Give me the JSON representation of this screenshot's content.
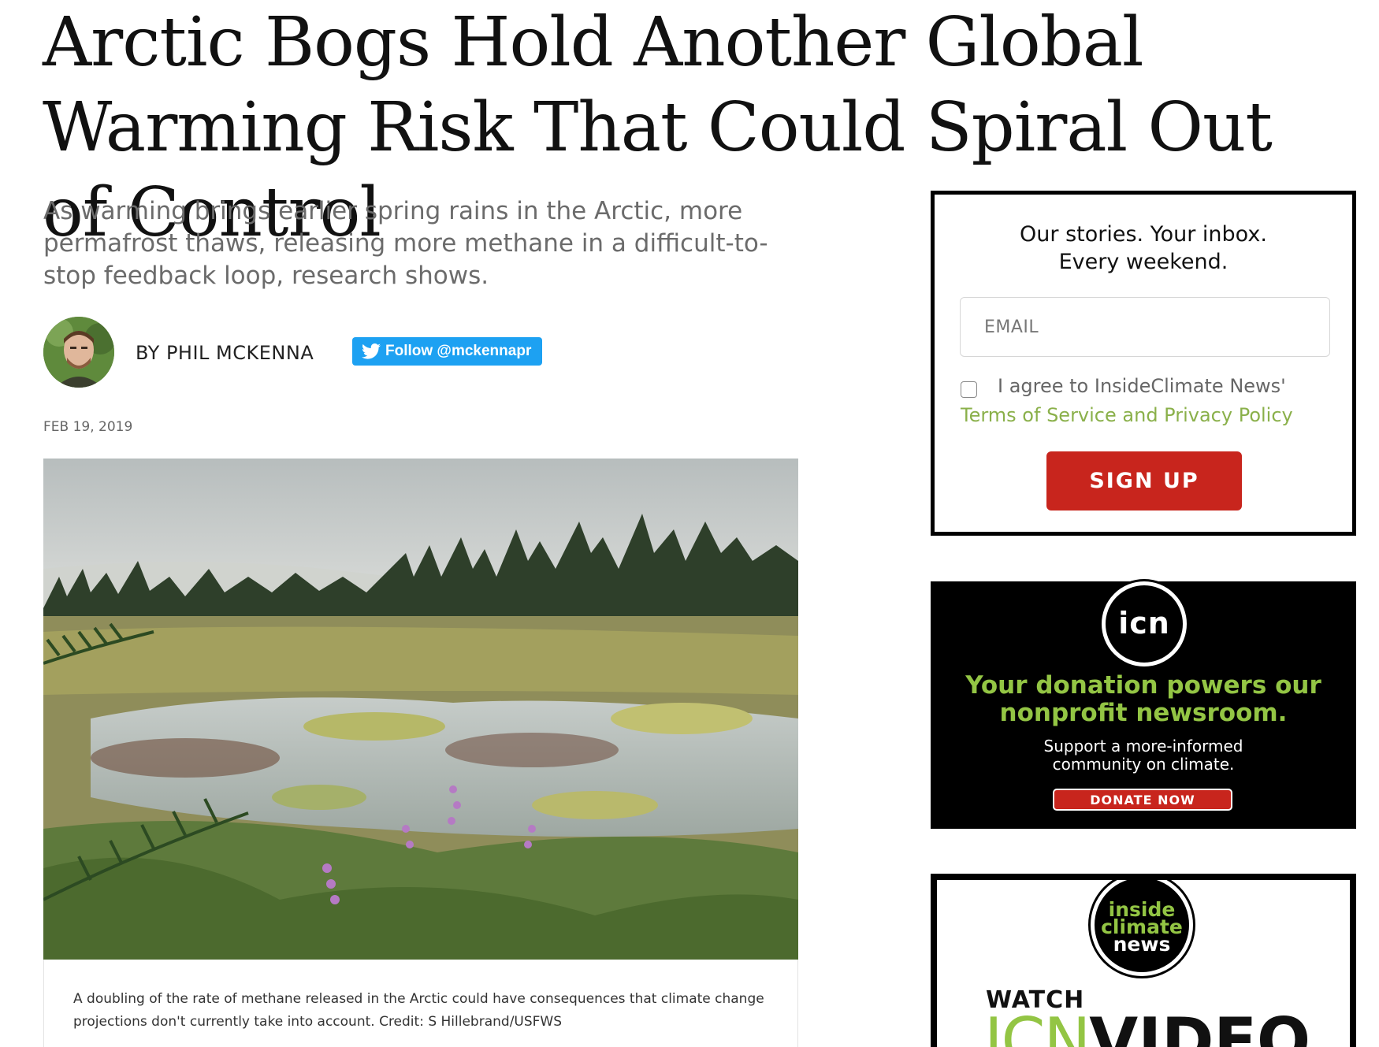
{
  "article": {
    "headline": "Arctic Bogs Hold Another Global Warming Risk That Could Spiral Out of Control",
    "dek": "As warming brings earlier spring rains in the Arctic, more permafrost thaws, releasing more methane in a difficult-to-stop feedback loop, research shows.",
    "byline": "BY PHIL MCKENNA",
    "follow_label": "Follow @mckennapr",
    "date": "FEB 19, 2019",
    "caption": "A doubling of the rate of methane released in the Arctic could have consequences that climate change projections don't currently take into account. Credit: S Hillebrand/USFWS"
  },
  "newsletter": {
    "title_line1": "Our stories. Your inbox.",
    "title_line2": "Every weekend.",
    "email_placeholder": "EMAIL",
    "agree_text": "I agree to InsideClimate News'",
    "terms_link": "Terms of Service and Privacy Policy",
    "signup_label": "SIGN UP"
  },
  "donate_ad": {
    "logo": "icn",
    "headline_line1": "Your donation powers our",
    "headline_line2": "nonprofit newsroom.",
    "sub_line1": "Support a more-informed",
    "sub_line2": "community on climate.",
    "button_label": "DONATE NOW"
  },
  "video_ad": {
    "logo_line1": "inside",
    "logo_line2": "climate",
    "logo_line3": "news",
    "watch": "WATCH",
    "icn": "ICN",
    "video": "VIDEO"
  },
  "colors": {
    "twitter_blue": "#1da1f2",
    "brand_red": "#c8251d",
    "brand_green": "#93c544",
    "link_green": "#8ab04a"
  },
  "icons": {
    "follow": "twitter-bird-icon"
  }
}
